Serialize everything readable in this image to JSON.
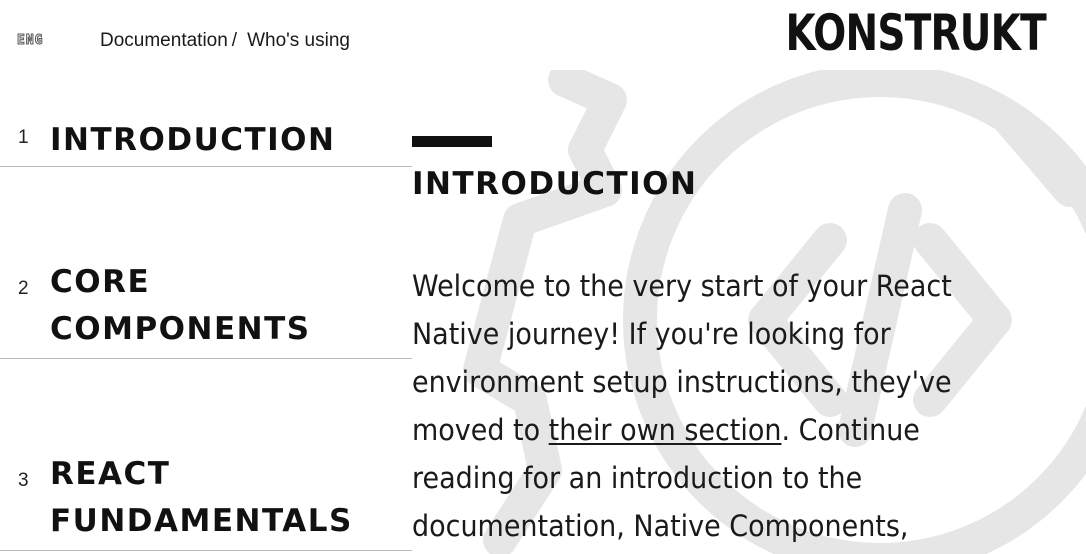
{
  "header": {
    "lang": "ENG",
    "breadcrumb": {
      "documentation": "Documentation",
      "separator": "/",
      "current": "Who's using"
    },
    "logo": "KONSTRUKT"
  },
  "sidebar": {
    "items": [
      {
        "number": "1",
        "title": "INTRODUCTION"
      },
      {
        "number": "2",
        "title": "CORE COMPONENTS"
      },
      {
        "number": "3",
        "title": "REACT FUNDAMENTALS"
      }
    ]
  },
  "content": {
    "title": "INTRODUCTION",
    "paragraph": {
      "before_link": "Welcome to the very start of your React Native journey! If you're looking for environment setup instructions, they've moved to ",
      "link": "their own section",
      "after_link": ". Continue reading for an introduction to the documentation, Native Components,"
    }
  },
  "colors": {
    "text": "#111111",
    "divider": "#bdbdbd",
    "background_art": "#e6e6e6"
  },
  "icons": {
    "background": "code-gear-illustration"
  }
}
